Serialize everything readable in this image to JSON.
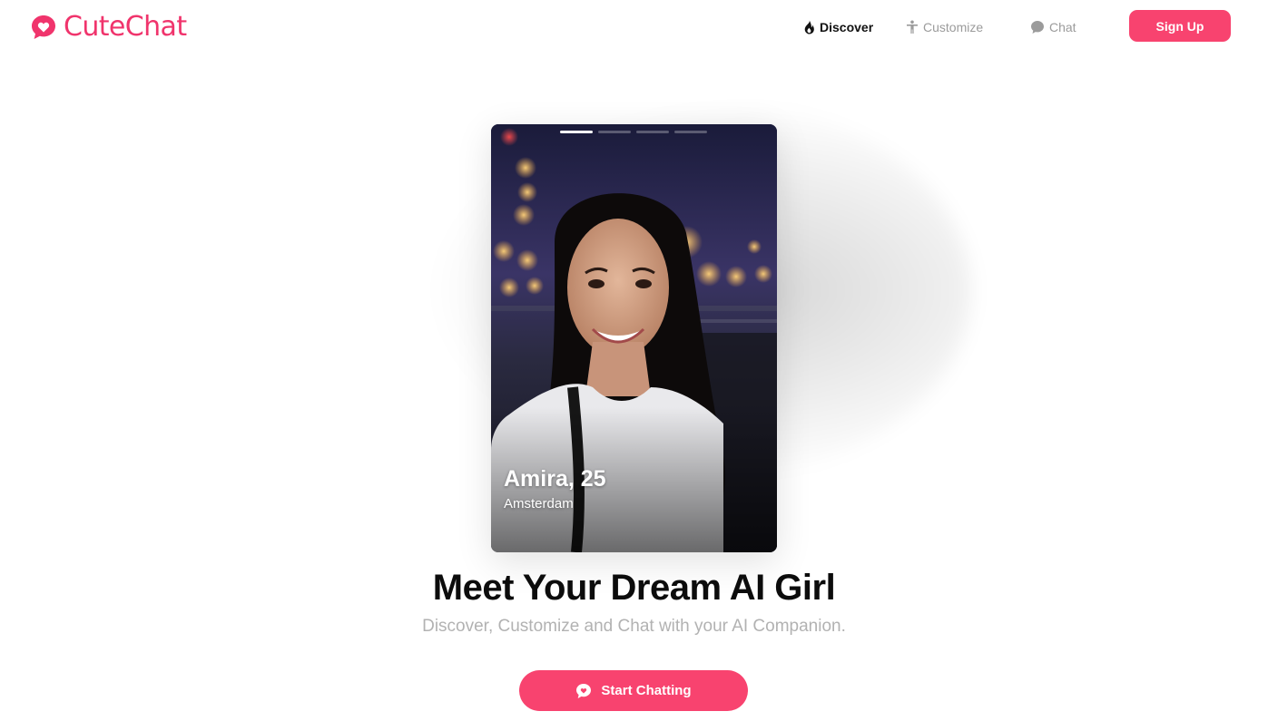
{
  "brand": {
    "name": "CuteChat",
    "color": "#f0346c"
  },
  "nav": {
    "items": [
      {
        "label": "Discover",
        "icon": "flame-icon",
        "active": true
      },
      {
        "label": "Customize",
        "icon": "person-icon",
        "active": false
      },
      {
        "label": "Chat",
        "icon": "chat-bubble-icon",
        "active": false
      }
    ],
    "signup_label": "Sign Up"
  },
  "hero_card": {
    "name_age": "Amira, 25",
    "city": "Amsterdam",
    "photo_count": 4,
    "active_photo": 1
  },
  "headline": "Meet Your Dream AI Girl",
  "subheadline": "Discover, Customize and Chat with your AI Companion.",
  "cta": {
    "label": "Start Chatting",
    "icon": "chat-bubble-icon"
  },
  "colors": {
    "accent": "#f8436f",
    "active_nav": "#111111",
    "inactive_nav": "#9b9b9b"
  }
}
